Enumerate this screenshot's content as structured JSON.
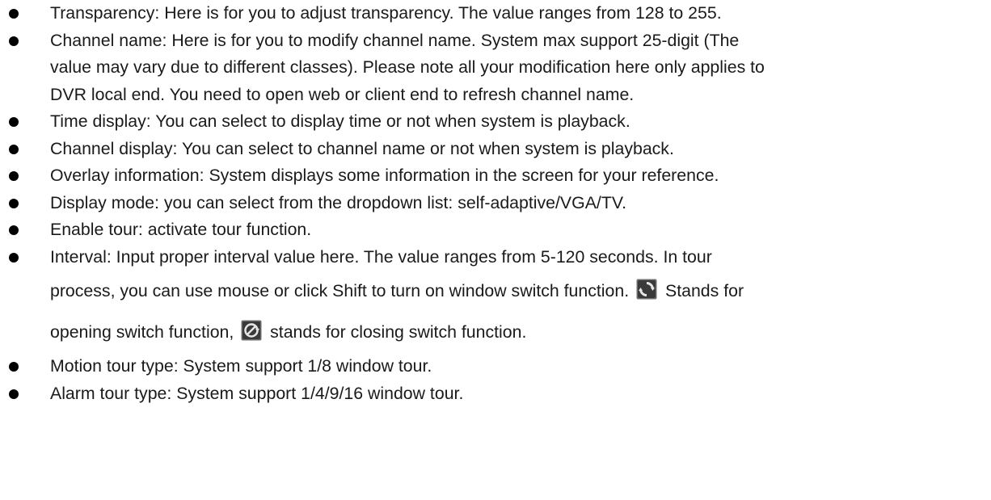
{
  "items": [
    {
      "label": "Transparency",
      "text": "Transparency: Here is for you to adjust transparency. The value ranges from 128 to 255."
    },
    {
      "label": "Channel name",
      "lines": [
        "Channel name: Here is for you to modify channel name. System max support 25-digit (The",
        "value may vary due to different classes). Please note all your modification here only applies to",
        "DVR local end. You need to open web or client end to refresh channel name."
      ]
    },
    {
      "label": "Time display",
      "text": "Time display: You can select to display time or not when system is playback."
    },
    {
      "label": "Channel display",
      "text": "Channel display: You can select to channel name or not when system is playback."
    },
    {
      "label": "Overlay information",
      "text": "Overlay information: System displays some information in the screen for your reference."
    },
    {
      "label": "Display mode",
      "text": "Display mode: you can select from the dropdown list: self-adaptive/VGA/TV."
    },
    {
      "label": "Enable tour",
      "text": "Enable tour: activate tour function."
    },
    {
      "label": "Interval",
      "line1": "Interval: Input proper interval value here. The value ranges from 5-120 seconds. In tour",
      "line2_before_icon": "process, you can use mouse or click Shift to turn on window switch function.",
      "line2_after_icon": "Stands for",
      "line3_before_icon": "opening switch function,",
      "line3_after_icon": "stands for closing switch function.",
      "icons": [
        "switch-open-icon",
        "switch-close-icon"
      ]
    },
    {
      "label": "Motion tour type",
      "text": "Motion tour type: System support 1/8 window tour."
    },
    {
      "label": "Alarm tour type",
      "text": "Alarm tour type: System support 1/4/9/16 window tour."
    }
  ],
  "colors": {
    "text": "#1a1a1a",
    "bullet": "#000000",
    "icon_bg_dark": "#3a3a3a",
    "icon_glyph": "#e6e6e6"
  }
}
